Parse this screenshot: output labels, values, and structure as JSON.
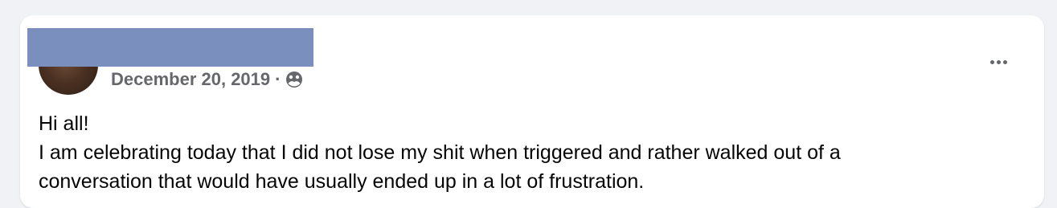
{
  "post": {
    "author_name": "",
    "date": "December 20, 2019",
    "separator": "·",
    "privacy_icon": "friends-globe-icon",
    "more_icon": "more-options-icon",
    "lines": [
      "Hi all!",
      "I am celebrating today that I did not lose my shit when triggered and rather walked out of a",
      "conversation that would have usually ended up in a lot of frustration."
    ]
  },
  "colors": {
    "background": "#f0f2f5",
    "card": "#ffffff",
    "redaction": "#7b8fbf",
    "meta_text": "#65676b",
    "body_text": "#050505"
  }
}
